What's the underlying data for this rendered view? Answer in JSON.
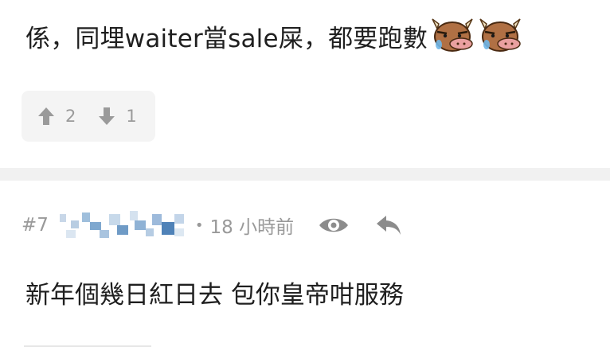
{
  "post": {
    "text": "係，同埋waiter當sale屎，都要跑數",
    "emojis": [
      "cow-face-emoji",
      "cow-face-emoji"
    ]
  },
  "votes": {
    "up_count": "2",
    "down_count": "1",
    "icons": {
      "up": "thumb-up-arrow-icon",
      "down": "thumb-down-arrow-icon"
    }
  },
  "reply": {
    "number": "#7",
    "username_state": "pixelated",
    "separator": "•",
    "time": "18 小時前",
    "icons": {
      "view": "eye-icon",
      "reply": "reply-arrow-icon"
    },
    "text": "新年個幾日紅日去 包你皇帝咁服務"
  },
  "colors": {
    "text": "#1f1f1f",
    "meta": "#999999",
    "vote_bg": "#f4f4f4",
    "divider": "#f1f1f1"
  }
}
